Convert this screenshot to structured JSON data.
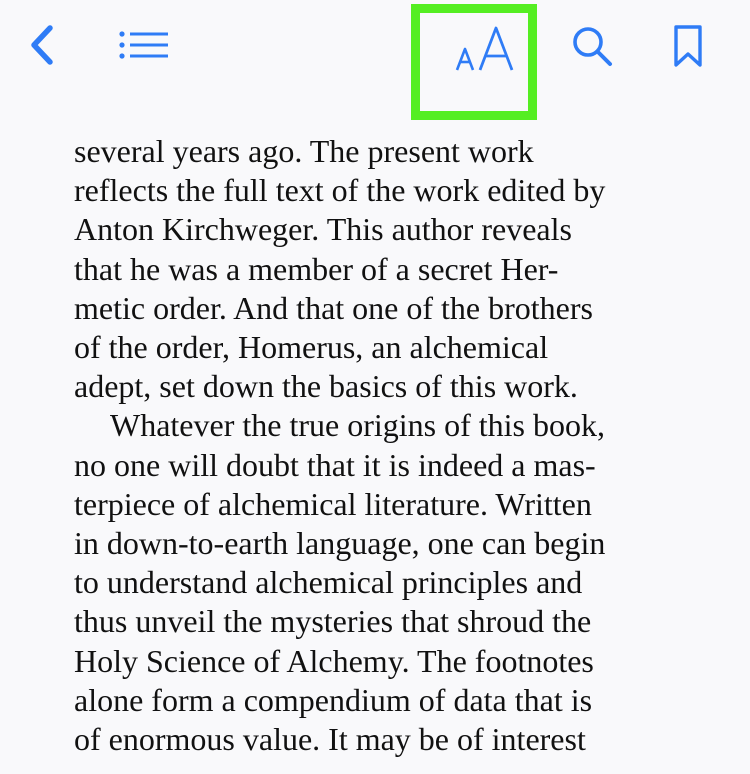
{
  "toolbar": {
    "back_icon": "chevron-left-icon",
    "toc_icon": "list-icon",
    "font_settings_icon": "text-size-icon",
    "font_settings_label": "AA",
    "search_icon": "search-icon",
    "bookmark_icon": "bookmark-icon",
    "accent_color": "#2f7cf6",
    "highlight_color": "#55ee22"
  },
  "book": {
    "paragraphs": [
      {
        "lines": [
          "several years ago. The present work",
          "reflects the full text of the work edited by",
          "Anton Kirchweger. This author reveals",
          "that he was a member of a secret Her-",
          "metic order. And that one of the brothers",
          "of the order, Homerus, an alchemical",
          "adept, set down the basics of this work."
        ]
      },
      {
        "lines": [
          "Whatever the true origins of this book,",
          "no one will doubt that it is indeed a mas-",
          "terpiece of alchemical literature. Written",
          "in down-to-earth language, one can begin",
          "to understand alchemical principles and",
          "thus unveil the mysteries that shroud the",
          "Holy Science of Alchemy. The footnotes",
          "alone form a compendium of data that is",
          "of enormous value. It may be of interest"
        ]
      }
    ]
  }
}
